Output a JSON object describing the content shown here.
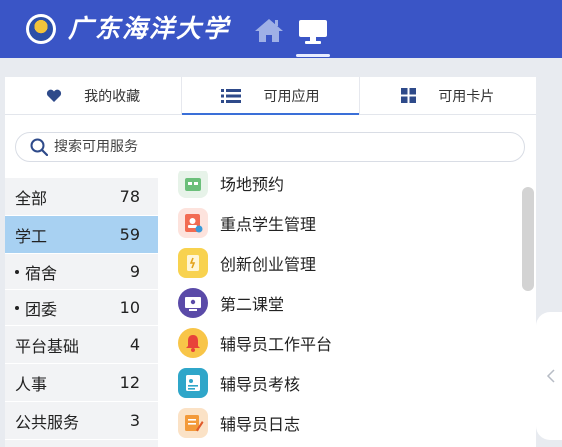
{
  "header": {
    "logo_text": "广东海洋大学",
    "nav": [
      {
        "icon": "home-icon",
        "active": false
      },
      {
        "icon": "desktop-icon",
        "active": true
      }
    ]
  },
  "tabs": [
    {
      "label": "我的收藏",
      "icon": "heart-icon"
    },
    {
      "label": "可用应用",
      "icon": "list-icon",
      "active": true
    },
    {
      "label": "可用卡片",
      "icon": "grid-icon"
    }
  ],
  "search": {
    "placeholder": "搜索可用服务",
    "value": ""
  },
  "categories": [
    {
      "name": "全部",
      "count": "78"
    },
    {
      "name": "学工",
      "count": "59",
      "active": true
    },
    {
      "name": "宿舍",
      "count": "9",
      "sub": true
    },
    {
      "name": "团委",
      "count": "10",
      "sub": true
    },
    {
      "name": "平台基础",
      "count": "4"
    },
    {
      "name": "人事",
      "count": "12"
    },
    {
      "name": "公共服务",
      "count": "3"
    }
  ],
  "apps": [
    {
      "name": "场地预约",
      "icon": "venue-booking-icon",
      "color": "#6bbf7a"
    },
    {
      "name": "重点学生管理",
      "icon": "key-student-icon",
      "color": "#f26b52"
    },
    {
      "name": "创新创业管理",
      "icon": "innovation-icon",
      "color": "#f5c542"
    },
    {
      "name": "第二课堂",
      "icon": "classroom-icon",
      "color": "#5a4aa8"
    },
    {
      "name": "辅导员工作平台",
      "icon": "bell-icon",
      "color": "#f5b62a"
    },
    {
      "name": "辅导员考核",
      "icon": "assessment-icon",
      "color": "#2fa6c9"
    },
    {
      "name": "辅导员日志",
      "icon": "journal-icon",
      "color": "#f39a3a"
    }
  ],
  "colors": {
    "brand": "#3a55c6",
    "active_category": "#a8d1f2",
    "tab_underline": "#3a6fd8"
  }
}
